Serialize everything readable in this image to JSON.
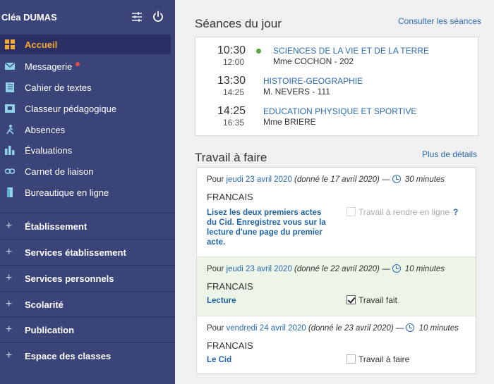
{
  "sidebar": {
    "user_name": "Cléa DUMAS",
    "nav": [
      {
        "label": "Accueil",
        "icon": "home-grid-icon",
        "active": true
      },
      {
        "label": "Messagerie",
        "icon": "envelope-icon",
        "notification": true
      },
      {
        "label": "Cahier de textes",
        "icon": "book-icon"
      },
      {
        "label": "Classeur pédagogique",
        "icon": "binder-icon"
      },
      {
        "label": "Absences",
        "icon": "person-running-icon"
      },
      {
        "label": "Évaluations",
        "icon": "bar-chart-icon"
      },
      {
        "label": "Carnet de liaison",
        "icon": "link-icon"
      },
      {
        "label": "Bureautique en ligne",
        "icon": "document-icon"
      }
    ],
    "sections": [
      {
        "label": "Établissement"
      },
      {
        "label": "Services établissement"
      },
      {
        "label": "Services personnels"
      },
      {
        "label": "Scolarité"
      },
      {
        "label": "Publication"
      },
      {
        "label": "Espace des classes"
      }
    ],
    "plus_symbol": "+"
  },
  "sessions": {
    "title": "Séances du jour",
    "link": "Consulter les séances",
    "items": [
      {
        "start": "10:30",
        "end": "12:00",
        "subject": "SCIENCES DE LA VIE ET DE LA TERRE",
        "teacher": "Mme COCHON - 202",
        "current": true
      },
      {
        "start": "13:30",
        "end": "14:25",
        "subject": "HISTOIRE-GEOGRAPHIE",
        "teacher": "M. NEVERS - 111",
        "current": false
      },
      {
        "start": "14:25",
        "end": "16:35",
        "subject": "EDUCATION PHYSIQUE ET SPORTIVE",
        "teacher": "Mme BRIERE",
        "current": false
      }
    ]
  },
  "homework": {
    "title": "Travail à faire",
    "link": "Plus de détails",
    "items": [
      {
        "prefix": "Pour",
        "due": "jeudi 23 avril 2020",
        "given": "(donné le 17 avril 2020)",
        "dash": "—",
        "duration": "30 minutes",
        "subject": "FRANCAIS",
        "description": "Lisez les deux premiers actes du Cid. Enregistrez vous sur la lecture d'une page du premier acte.",
        "checkbox_label": "Travail à rendre en ligne",
        "checked": false,
        "help": "?"
      },
      {
        "prefix": "Pour",
        "due": "jeudi 23 avril 2020",
        "given": "(donné le 22 avril 2020)",
        "dash": "—",
        "duration": "10 minutes",
        "subject": "FRANCAIS",
        "description": "Lecture",
        "checkbox_label": "Travail fait",
        "checked": true
      },
      {
        "prefix": "Pour",
        "due": "vendredi 24 avril 2020",
        "given": "(donné le 23 avril 2020)",
        "dash": "—",
        "duration": "10 minutes",
        "subject": "FRANCAIS",
        "description": "Le Cid",
        "checkbox_label": "Travail à faire",
        "checked": false
      }
    ]
  },
  "colors": {
    "sidebar_bg": "#3b4479",
    "active_accent": "#f7a830",
    "link_blue": "#2a6bb5",
    "done_bg": "#edf4e8",
    "current_dot": "#5aa53e"
  }
}
